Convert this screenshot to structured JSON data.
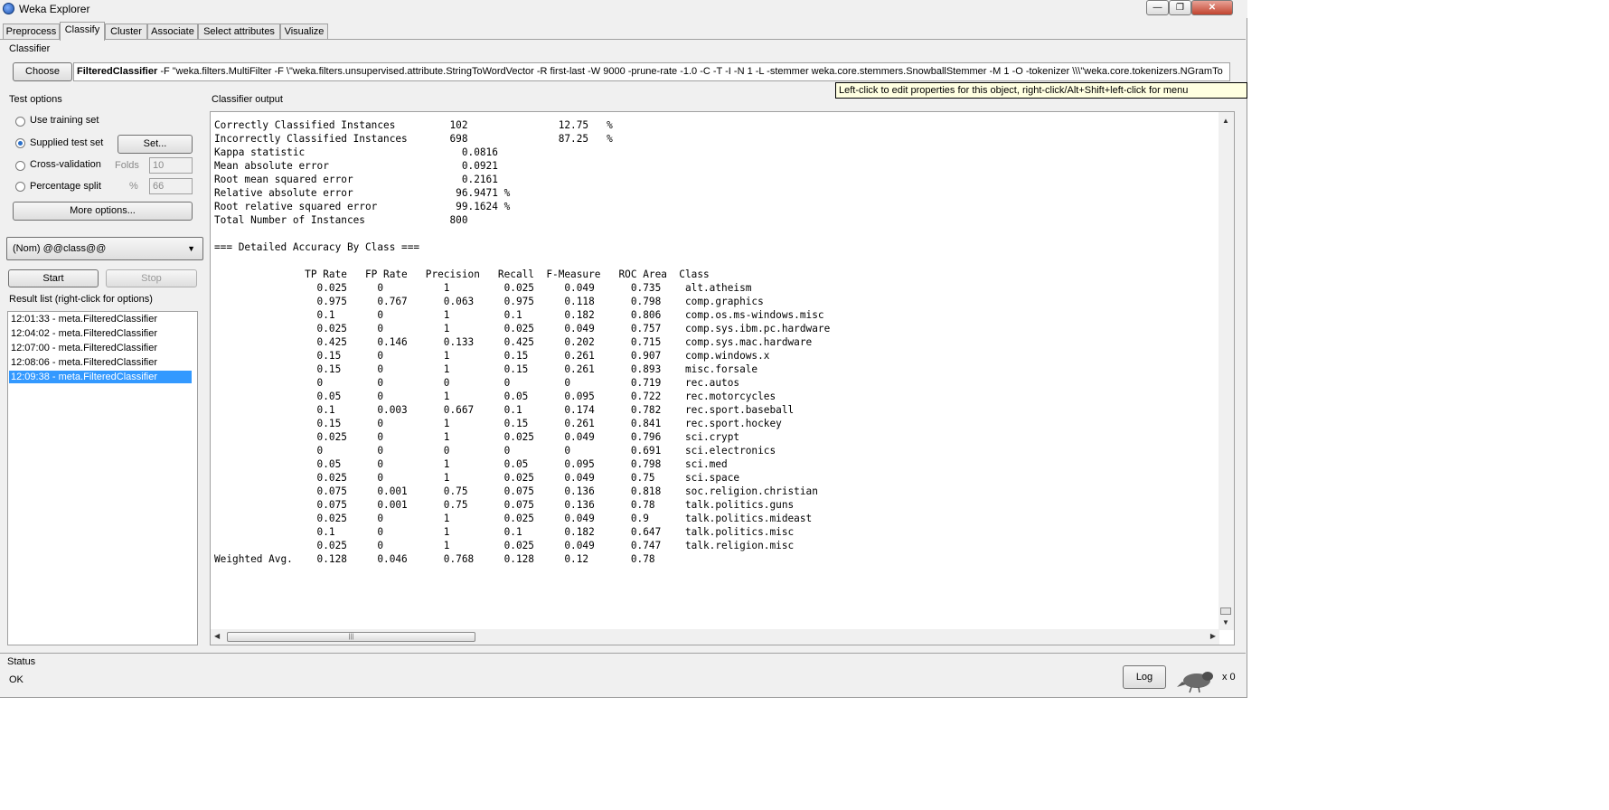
{
  "window": {
    "title": "Weka Explorer"
  },
  "tabs": [
    "Preprocess",
    "Classify",
    "Cluster",
    "Associate",
    "Select attributes",
    "Visualize"
  ],
  "classifier": {
    "section_label": "Classifier",
    "choose_label": "Choose",
    "name": "FilteredClassifier",
    "options": " -F \"weka.filters.MultiFilter -F \\\"weka.filters.unsupervised.attribute.StringToWordVector -R first-last -W 9000 -prune-rate -1.0 -C -T -I -N 1 -L -stemmer weka.core.stemmers.SnowballStemmer -M 1 -O -tokenizer \\\\\\\"weka.core.tokenizers.NGramTo"
  },
  "tooltip": "Left-click to edit properties for this object, right-click/Alt+Shift+left-click for menu",
  "test_options": {
    "section_label": "Test options",
    "use_training": "Use training set",
    "supplied": "Supplied test set",
    "set_button": "Set...",
    "cross_validation": "Cross-validation",
    "folds_label": "Folds",
    "folds_value": "10",
    "percentage_split": "Percentage split",
    "percent_label": "%",
    "percent_value": "66",
    "more_options": "More options...",
    "selected": "Supplied test set"
  },
  "class_selector": "(Nom) @@class@@",
  "start_label": "Start",
  "stop_label": "Stop",
  "result_list": {
    "label": "Result list (right-click for options)",
    "items": [
      "12:01:33 - meta.FilteredClassifier",
      "12:04:02 - meta.FilteredClassifier",
      "12:07:00 - meta.FilteredClassifier",
      "12:08:06 - meta.FilteredClassifier",
      "12:09:38 - meta.FilteredClassifier"
    ],
    "selected_index": 4
  },
  "output": {
    "label": "Classifier output",
    "text": "Correctly Classified Instances         102               12.75   %\nIncorrectly Classified Instances       698               87.25   %\nKappa statistic                          0.0816\nMean absolute error                      0.0921\nRoot mean squared error                  0.2161\nRelative absolute error                 96.9471 %\nRoot relative squared error             99.1624 %\nTotal Number of Instances              800     \n\n=== Detailed Accuracy By Class ===\n\n               TP Rate   FP Rate   Precision   Recall  F-Measure   ROC Area  Class\n                 0.025     0          1         0.025     0.049      0.735    alt.atheism\n                 0.975     0.767      0.063     0.975     0.118      0.798    comp.graphics\n                 0.1       0          1         0.1       0.182      0.806    comp.os.ms-windows.misc\n                 0.025     0          1         0.025     0.049      0.757    comp.sys.ibm.pc.hardware\n                 0.425     0.146      0.133     0.425     0.202      0.715    comp.sys.mac.hardware\n                 0.15      0          1         0.15      0.261      0.907    comp.windows.x\n                 0.15      0          1         0.15      0.261      0.893    misc.forsale\n                 0         0          0         0         0          0.719    rec.autos\n                 0.05      0          1         0.05      0.095      0.722    rec.motorcycles\n                 0.1       0.003      0.667     0.1       0.174      0.782    rec.sport.baseball\n                 0.15      0          1         0.15      0.261      0.841    rec.sport.hockey\n                 0.025     0          1         0.025     0.049      0.796    sci.crypt\n                 0         0          0         0         0          0.691    sci.electronics\n                 0.05      0          1         0.05      0.095      0.798    sci.med\n                 0.025     0          1         0.025     0.049      0.75     sci.space\n                 0.075     0.001      0.75      0.075     0.136      0.818    soc.religion.christian\n                 0.075     0.001      0.75      0.075     0.136      0.78     talk.politics.guns\n                 0.025     0          1         0.025     0.049      0.9      talk.politics.mideast\n                 0.1       0          1         0.1       0.182      0.647    talk.politics.misc\n                 0.025     0          1         0.025     0.049      0.747    talk.religion.misc\nWeighted Avg.    0.128     0.046      0.768     0.128     0.12       0.78"
  },
  "status": {
    "label": "Status",
    "text": "OK"
  },
  "log_label": "Log",
  "task_count": "x 0",
  "icons": {
    "app": "weka-app-icon",
    "minimize": "minimize-icon",
    "maximize": "maximize-icon",
    "close": "close-icon",
    "dropdown": "chevron-down-icon",
    "status_bird": "weka-bird-icon"
  },
  "colors": {
    "selection": "#3399ff",
    "tooltip_bg": "#ffffe1",
    "window_bg": "#f0f0f0"
  }
}
